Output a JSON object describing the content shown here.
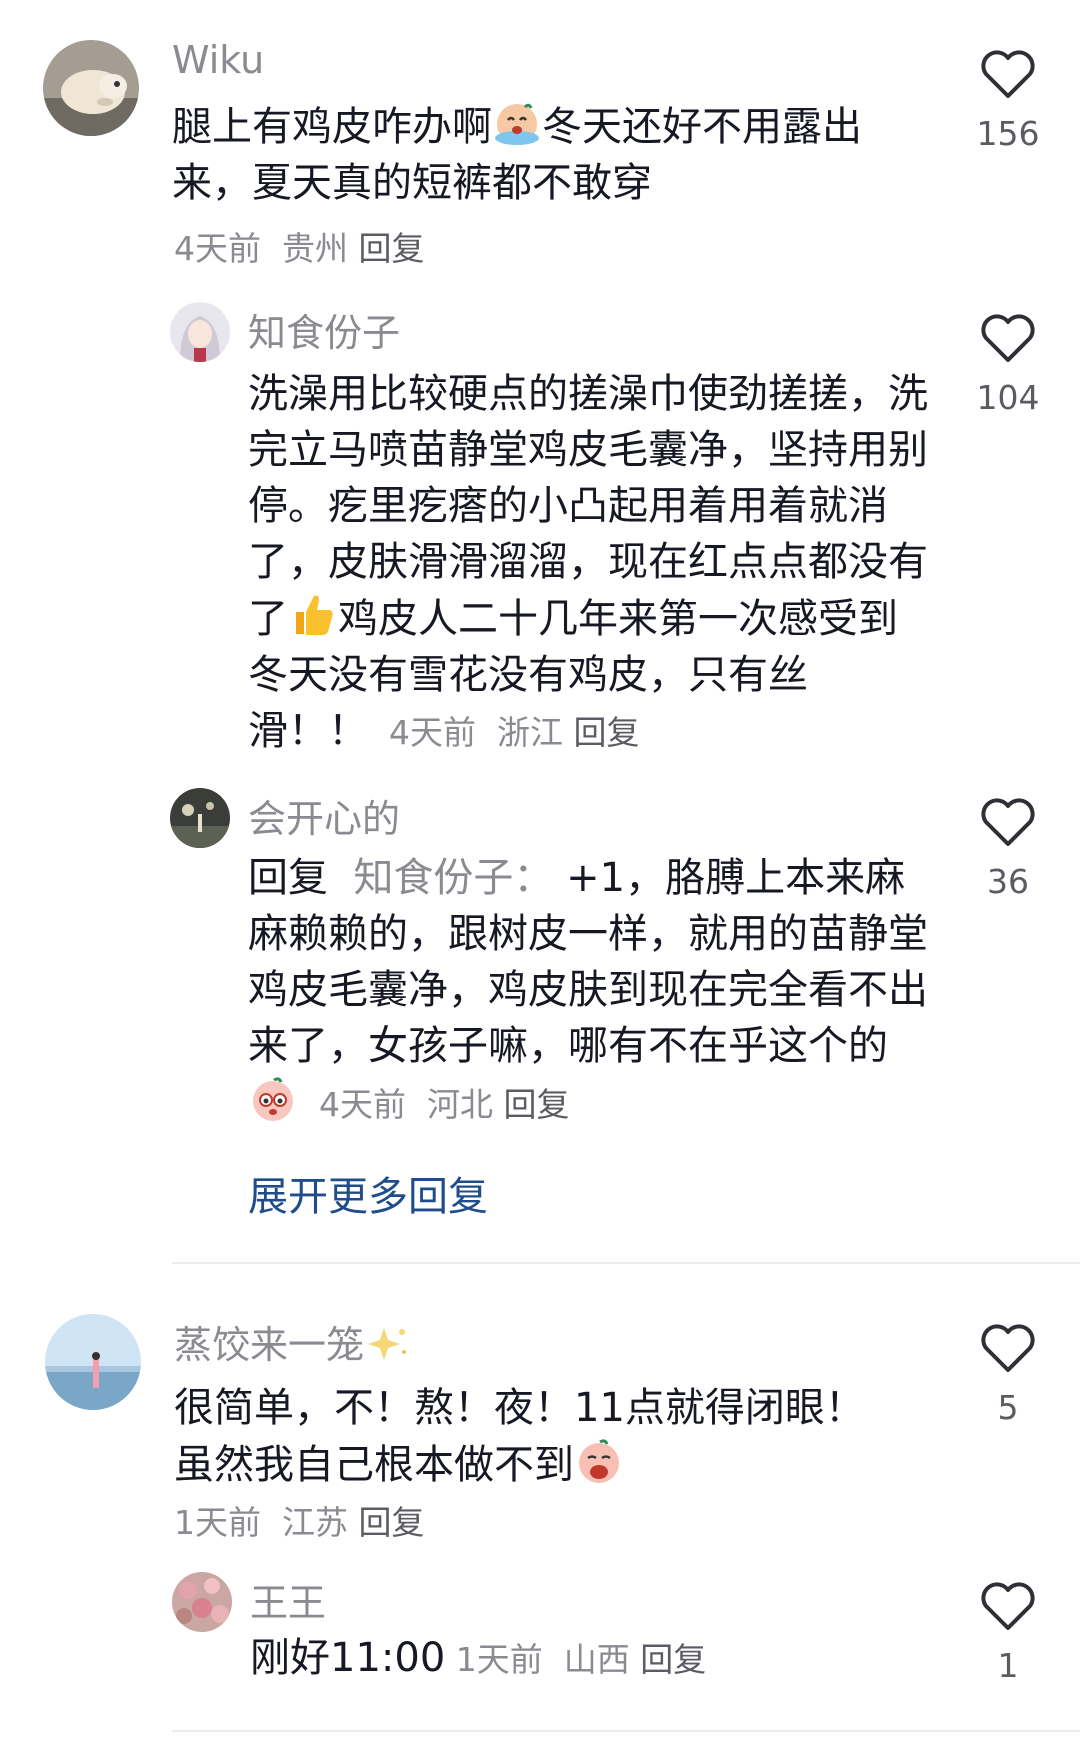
{
  "comments": [
    {
      "username": "Wiku",
      "text_a": "腿上有鸡皮咋办啊",
      "text_b": "冬天还好不用露出来，夏天真的短裤都不敢穿",
      "time": "4天前",
      "location": "贵州",
      "reply_label": "回复",
      "likes": "156",
      "emoji": "crying-face-emoji"
    },
    {
      "username": "知食份子",
      "text_a": "洗澡用比较硬点的搓澡巾使劲搓搓，洗完立马喷苗静堂鸡皮毛囊净，坚持用别停。疙里疙瘩的小凸起用着用着就消了，皮肤滑滑溜溜，现在红点点都没有了",
      "text_b": "鸡皮人二十几年来第一次感受到冬天没有雪花没有鸡皮，只有丝滑！！",
      "time": "4天前",
      "location": "浙江",
      "reply_label": "回复",
      "likes": "104",
      "emoji": "thumbs-up-emoji"
    },
    {
      "username": "会开心的",
      "reply_prefix": "回复",
      "mention": "知食份子：",
      "text_a": "+1，胳膊上本来麻麻赖赖的，跟树皮一样，就用的苗静堂鸡皮毛囊净，鸡皮肤到现在完全看不出来了，女孩子嘛，哪有不在乎这个的",
      "time": "4天前",
      "location": "河北",
      "reply_label": "回复",
      "likes": "36",
      "emoji": "shy-face-emoji"
    },
    {
      "username": "蒸饺来一笼",
      "text_a": "很简单，不！熬！夜！11点就得闭眼！",
      "text_b": "虽然我自己根本做不到",
      "time": "1天前",
      "location": "江苏",
      "reply_label": "回复",
      "likes": "5",
      "emoji": "yawning-face-emoji"
    },
    {
      "username": "王王",
      "text_a": "刚好11:00",
      "time": "1天前",
      "location": "山西",
      "reply_label": "回复",
      "likes": "1"
    }
  ],
  "expand_label": "展开更多回复",
  "colors": {
    "accent": "#1f4d8b",
    "muted": "#8a8b91",
    "text": "#161823"
  },
  "icons": {
    "like": "heart-outline-icon",
    "sparkle": "sparkle-icon"
  }
}
